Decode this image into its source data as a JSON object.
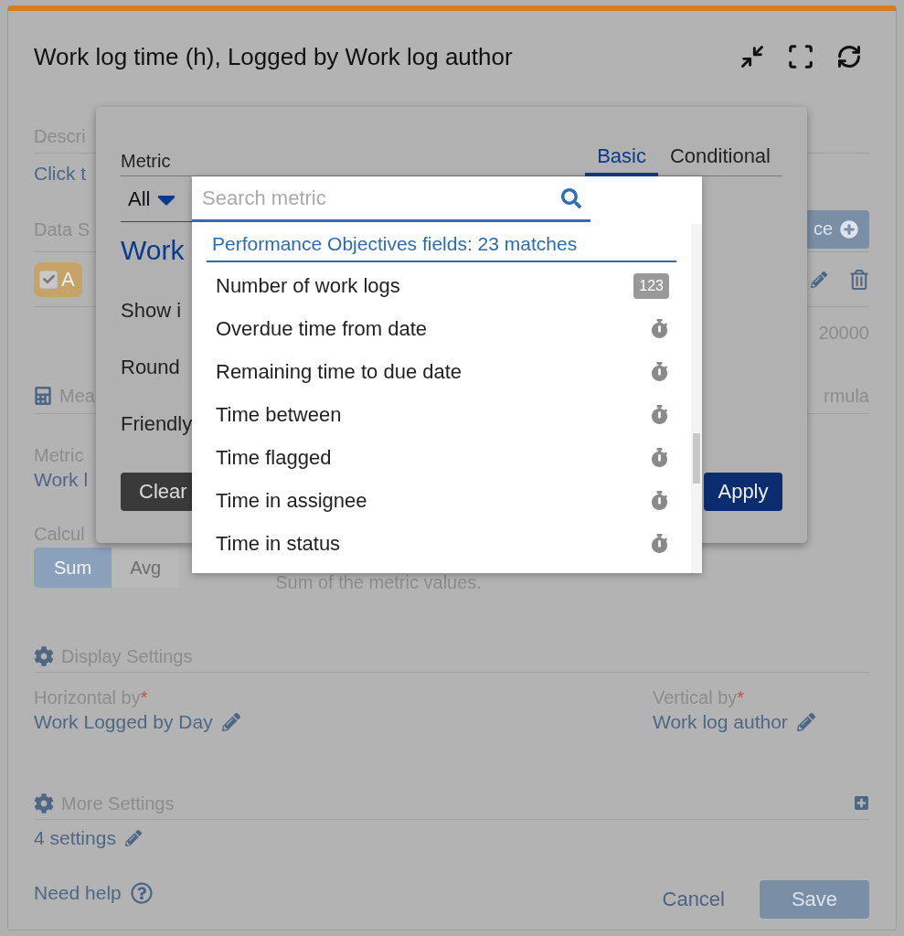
{
  "widget": {
    "title": "Work log time (h), Logged by Work log author"
  },
  "background": {
    "description": {
      "label": "Descri",
      "value": "Click t"
    },
    "data_source": {
      "label": "Data S",
      "add_button": "ce",
      "chip": {
        "label": "A",
        "checked": true
      }
    },
    "limit_value": "20000",
    "measure": {
      "label": "Mea",
      "formula": "rmula",
      "metric_label": "Metric",
      "metric_value": "Work l",
      "calc_label": "Calcul",
      "calc_options": [
        {
          "label": "Sum",
          "selected": true
        },
        {
          "label": "Avg",
          "selected": false
        }
      ],
      "calc_hint": "Sum of the metric values."
    },
    "display_settings": {
      "title": "Display Settings",
      "horizontal_label": "Horizontal by",
      "horizontal_value": "Work Logged by Day",
      "vertical_label": "Vertical by",
      "vertical_value": "Work log author",
      "required_mark": "*"
    },
    "more_settings": {
      "title": "More Settings",
      "value": "4 settings"
    },
    "footer": {
      "help": "Need help",
      "cancel": "Cancel",
      "save": "Save"
    }
  },
  "metric_dialog": {
    "label": "Metric",
    "tabs": [
      {
        "label": "Basic",
        "selected": true
      },
      {
        "label": "Conditional",
        "selected": false
      }
    ],
    "filter": "All",
    "metric_name": "Work",
    "rows": [
      "Show i",
      "Round",
      "Friendly"
    ],
    "clear": "Clear",
    "apply": "Apply"
  },
  "metric_dropdown": {
    "search": {
      "placeholder": "Search metric"
    },
    "group": "Performance Objectives fields: 23 matches",
    "items": [
      {
        "label": "Number of work logs",
        "kind": "number",
        "badge": "123"
      },
      {
        "label": "Overdue time from date",
        "kind": "timer"
      },
      {
        "label": "Remaining time to due date",
        "kind": "timer"
      },
      {
        "label": "Time between",
        "kind": "timer"
      },
      {
        "label": "Time flagged",
        "kind": "timer"
      },
      {
        "label": "Time in assignee",
        "kind": "timer"
      },
      {
        "label": "Time in status",
        "kind": "timer"
      }
    ]
  }
}
